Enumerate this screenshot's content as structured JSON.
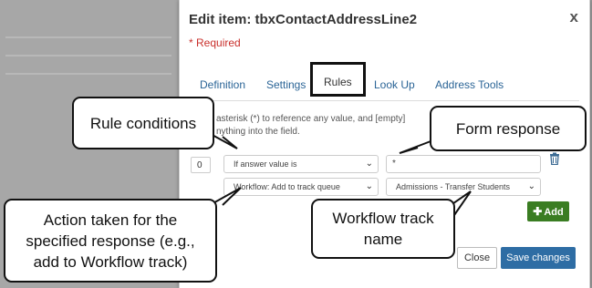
{
  "modal": {
    "title": "Edit item: tbxContactAddressLine2",
    "close_label": "x",
    "required_label": "* Required",
    "tabs": [
      {
        "label": "Definition"
      },
      {
        "label": "Settings"
      },
      {
        "label": "Rules"
      },
      {
        "label": "Look Up"
      },
      {
        "label": "Address Tools"
      }
    ],
    "helper_line1": "asterisk (*) to reference any value, and [empty]",
    "helper_line2": "nything into the field.",
    "rule": {
      "order": "0",
      "condition": "If answer value is",
      "value": "*",
      "action": "Workflow: Add to track queue",
      "track": "Admissions - Transfer Students"
    },
    "add_label": "Add",
    "close_button": "Close",
    "save_button": "Save changes"
  },
  "callouts": {
    "rule_conditions": "Rule conditions",
    "form_response": "Form response",
    "action_taken": "Action taken for the specified response (e.g., add to Workflow track)",
    "workflow_track": "Workflow track name"
  },
  "icons": {
    "close": "close-icon",
    "chevron": "chevron-down-icon",
    "trash": "trash-icon",
    "plus": "plus-icon"
  },
  "colors": {
    "required": "#c9302c",
    "link": "#2a6496",
    "add_button": "#3a7d22",
    "save_button": "#2e6da4"
  }
}
